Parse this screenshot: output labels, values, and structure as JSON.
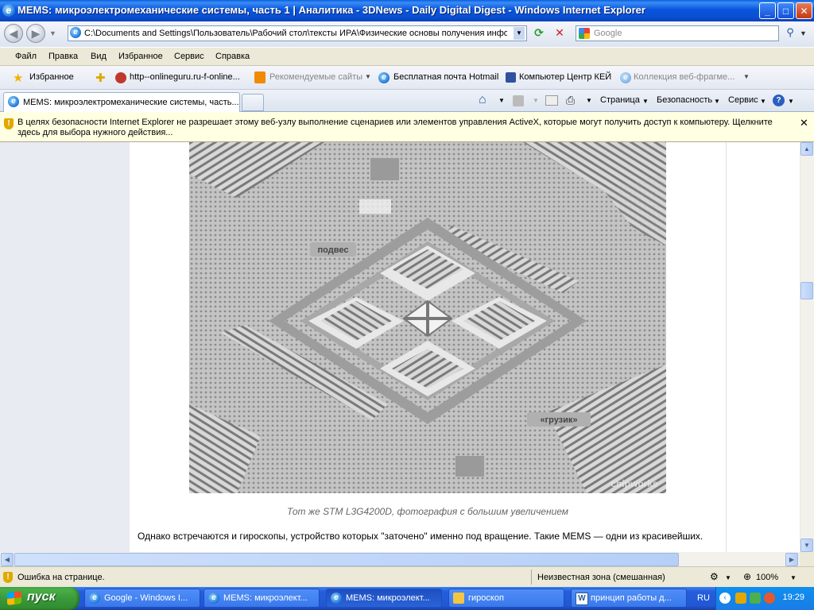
{
  "window": {
    "title": "MEMS: микроэлектромеханические системы, часть 1 | Аналитика - 3DNews - Daily Digital Digest - Windows Internet Explorer",
    "buttons": {
      "minimize": "_",
      "maximize": "□",
      "close": "✕"
    }
  },
  "address": {
    "url": "C:\\Documents and Settings\\Пользователь\\Рабочий стол\\тексты ИРА\\Физические основы получения инфор",
    "search_placeholder": "Google"
  },
  "menu": [
    "Файл",
    "Правка",
    "Вид",
    "Избранное",
    "Сервис",
    "Справка"
  ],
  "favorites": {
    "favorites_label": "Избранное",
    "items": [
      "http--onlineguru.ru-f-online...",
      "Рекомендуемые сайты",
      "Бесплатная почта Hotmail",
      "Компьютер Центр КЕЙ",
      "Коллекция веб-фрагме..."
    ]
  },
  "tabs": {
    "active_tab": "MEMS: микроэлектромеханические системы, часть...",
    "commands": [
      "Страница",
      "Безопасность",
      "Сервис"
    ]
  },
  "infobar": {
    "message": "В целях безопасности Internet Explorer не разрешает этому веб-узлу выполнение сценариев или элементов управления ActiveX, которые могут получить доступ к компьютеру. Щелкните здесь для выбора нужного действия..."
  },
  "article": {
    "photo_labels": {
      "label1": "подвес",
      "label2": "«грузик»",
      "watermark": "chipworks"
    },
    "caption": "Тот же STM L3G4200D, фотография с большим увеличением",
    "paragraph": "Однако встречаются и гироскопы, устройство которых \"заточено\" именно под вращение. Такие MEMS — одни из красивейших."
  },
  "status": {
    "left": "Ошибка на странице.",
    "zone": "Неизвестная зона (смешанная)",
    "zoom": "100%"
  },
  "taskbar": {
    "start": "пуск",
    "tasks": [
      "Google - Windows I...",
      "MEMS: микроэлект...",
      "MEMS: микроэлект...",
      "гироскоп",
      "принцип работы д..."
    ],
    "lang": "RU",
    "clock": "19:29"
  }
}
